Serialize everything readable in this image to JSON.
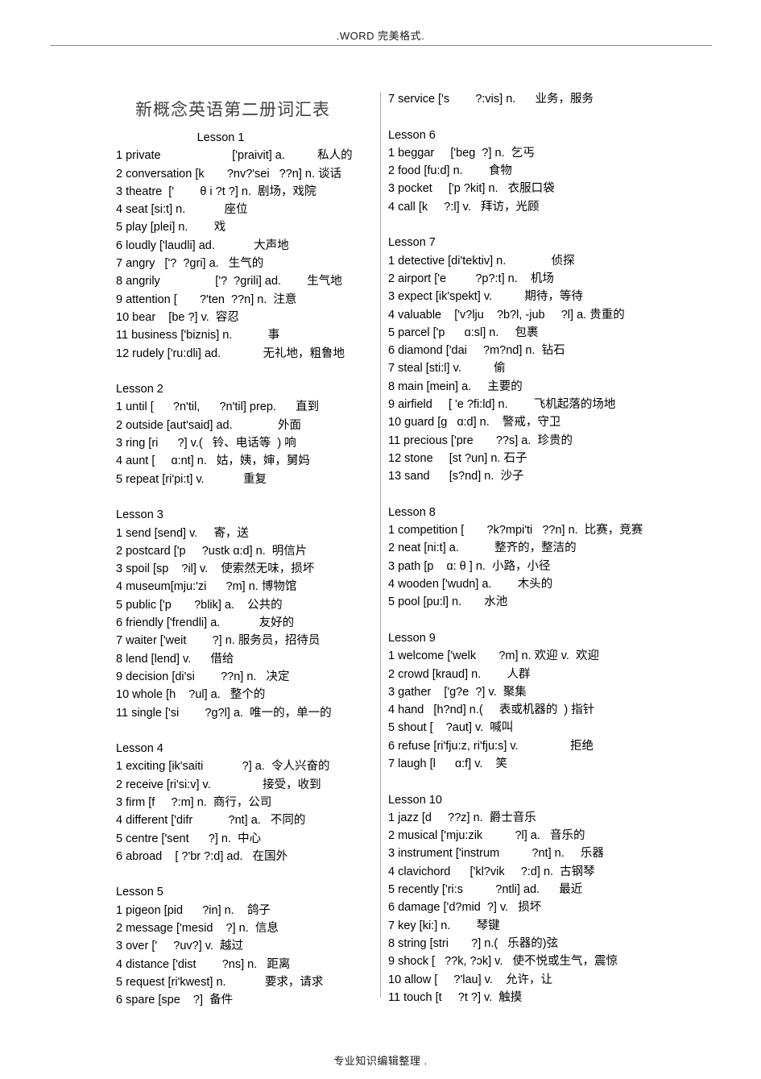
{
  "header": {
    "text": ".WORD 完美格式."
  },
  "footer": {
    "text": "专业知识编辑整理  ."
  },
  "document": {
    "title": "新概念英语第二册词汇表"
  },
  "left_column": {
    "lesson1_head": "Lesson 1",
    "lesson1": [
      "1 private                      ['praivit] a.          私人的",
      "2 conversation [k       ?nv?'sei   ??n] n. 谈话",
      "3 theatre  ['        θ i ?t ?] n.  剧场，戏院",
      "4 seat [si:t] n.            座位",
      "5 play [plei] n.        戏",
      "6 loudly ['laudli] ad.            大声地",
      "7 angry   ['?  ?gri] a.   生气的",
      "8 angrily                 ['?  ?grili] ad.        生气地",
      "9 attention [       ?'ten  ??n] n.  注意",
      "10 bear    [be ?] v.  容忍",
      "11 business ['biznis] n.           事",
      "12 rudely ['ru:dli] ad.             无礼地，粗鲁地"
    ],
    "lesson2_head": "Lesson 2",
    "lesson2": [
      "1 until [      ?n'til,      ?n'til] prep.      直到",
      "2 outside [aut'said] ad.              外面",
      "3 ring [ri      ?] v.(   铃、电话等  ) 响",
      "4 aunt [     ɑ:nt] n.   姑，姨，婶，舅妈",
      "5 repeat [ri'pi:t] v.            重复"
    ],
    "lesson3_head": "Lesson 3",
    "lesson3": [
      "1 send [send] v.     寄，送",
      "2 postcard ['p     ?ustk ɑ:d] n.  明信片",
      "3 spoil [sp    ?il] v.    使索然无味，损坏",
      "4 museum[mju:'zi      ?m] n. 博物馆",
      "5 public ['p       ?blik] a.    公共的",
      "6 friendly ['frendli] a.            友好的",
      "7 waiter ['weit        ?] n. 服务员，招待员",
      "8 lend [lend] v.      借给",
      "9 decision [di'si        ??n] n.   决定",
      "10 whole [h    ?ul] a.   整个的",
      "11 single ['si        ?g?l] a.  唯一的，单一的"
    ],
    "lesson4_head": "Lesson 4",
    "lesson4": [
      "1 exciting [ik'saiti            ?] a.  令人兴奋的",
      "2 receive [ri'si:v] v.                接受，收到",
      "3 firm [f     ?:m] n.  商行，公司",
      "4 different ['difr           ?nt] a.   不同的",
      "5 centre ['sent      ?] n.  中心",
      "6 abroad    [ ?'br ?:d] ad.   在国外"
    ],
    "lesson5_head": "Lesson 5",
    "lesson5": [
      "1 pigeon [pid      ?in] n.    鸽子",
      "2 message ['mesid    ?] n.  信息",
      "3 over ['     ?uv?] v.  越过",
      "4 distance ['dist        ?ns] n.   距离",
      "5 request [ri'kwest] n.            要求，请求",
      "6 spare [spe    ?]  备件"
    ]
  },
  "right_column": {
    "lesson5_cont": [
      "7 service ['s        ?:vis] n.      业务，服务"
    ],
    "lesson6_head": "Lesson 6",
    "lesson6": [
      "1 beggar     ['beg  ?] n.  乞丐",
      "2 food [fu:d] n.        食物",
      "3 pocket     ['p ?kit] n.   衣服口袋",
      "4 call [k     ?:l] v.   拜访，光顾"
    ],
    "lesson7_head": "Lesson 7",
    "lesson7": [
      "1 detective [di'tektiv] n.              侦探",
      "2 airport ['e         ?p?:t] n.    机场",
      "3 expect [ik'spekt] v.          期待，等待",
      "4 valuable    ['v?lju    ?b?l, -jub     ?l] a. 贵重的",
      "5 parcel ['p      ɑ:sl] n.     包裹",
      "6 diamond ['dai     ?m?nd] n.  钻石",
      "7 steal [sti:l] v.          偷",
      "8 main [mein] a.     主要的",
      "9 airfield     [ 'e ?fi:ld] n.        飞机起落的场地",
      "10 guard [g   ɑ:d] n.    警戒，守卫",
      "11 precious ['pre       ??s] a.  珍贵的",
      "12 stone     [st ?un] n. 石子",
      "13 sand      [s?nd] n.  沙子"
    ],
    "lesson8_head": "Lesson 8",
    "lesson8": [
      "1 competition [       ?k?mpi'ti   ??n] n.  比赛，竞赛",
      "2 neat [ni:t] a.           整齐的，整洁的",
      "3 path [p    ɑ: θ ] n.  小路，小径",
      "4 wooden ['wudn] a.        木头的",
      "5 pool [pu:l] n.       水池"
    ],
    "lesson9_head": "Lesson 9",
    "lesson9": [
      "1 welcome ['welk       ?m] n. 欢迎 v.  欢迎",
      "2 crowd [kraud] n.        人群",
      "3 gather    ['g?e  ?] v.  聚集",
      "4 hand   [h?nd] n.(     表或机器的  ) 指针",
      "5 shout [    ?aut] v.  喊叫",
      "6 refuse [ri'fju:z, ri'fju:s] v.                拒绝",
      "7 laugh [l      ɑ:f] v.    笑"
    ],
    "lesson10_head": "Lesson 10",
    "lesson10": [
      "1 jazz [d     ??z] n.  爵士音乐",
      "2 musical ['mju:zik          ?l] a.   音乐的",
      "3 instrument ['instrum          ?nt] n.     乐器",
      "4 clavichord      ['kl?vik     ?:d] n.  古钢琴",
      "5 recently ['ri:s          ?ntli] ad.      最近",
      "6 damage ['d?mid  ?] v.   损坏",
      "7 key [ki:] n.        琴键",
      "8 string [stri       ?] n.(   乐器的)弦",
      "9 shock [   ??k, ?ɔk] v.   使不悦或生气，震惊",
      "10 allow [     ?'lau] v.    允许，让",
      "11 touch [t     ?t ?] v.  触摸"
    ]
  }
}
